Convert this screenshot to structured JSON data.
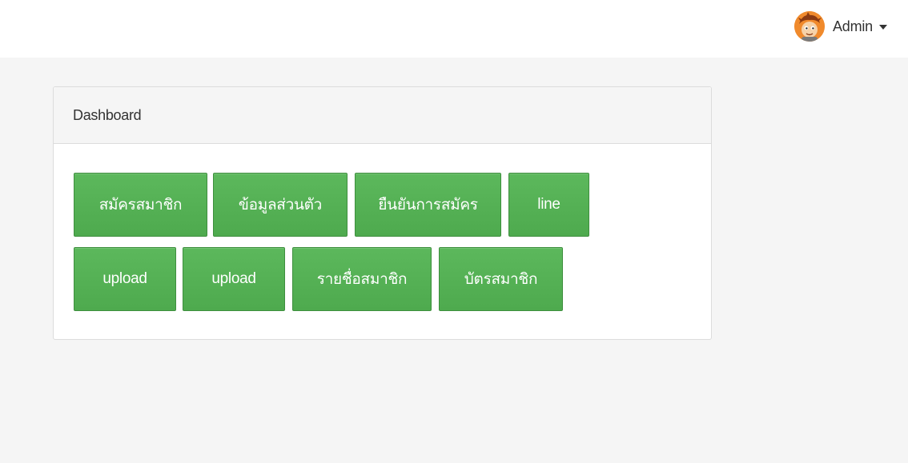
{
  "header": {
    "user_name": "Admin",
    "avatar_icon": "avatar-cartoon-icon",
    "caret_icon": "caret-down-icon"
  },
  "panel": {
    "title": "Dashboard"
  },
  "buttons": [
    {
      "label": "สมัครสมาชิก"
    },
    {
      "label": "ข้อมูลส่วนตัว"
    },
    {
      "label": "ยืนยันการสมัคร"
    },
    {
      "label": "line"
    },
    {
      "label": "upload"
    },
    {
      "label": "upload"
    },
    {
      "label": "รายชื่อสมาชิก"
    },
    {
      "label": "บัตรสมาชิก"
    }
  ],
  "colors": {
    "button_green": "#5cb85c",
    "button_border": "#3e8f3e",
    "background": "#f5f5f5",
    "avatar_orange": "#f08a2c"
  }
}
